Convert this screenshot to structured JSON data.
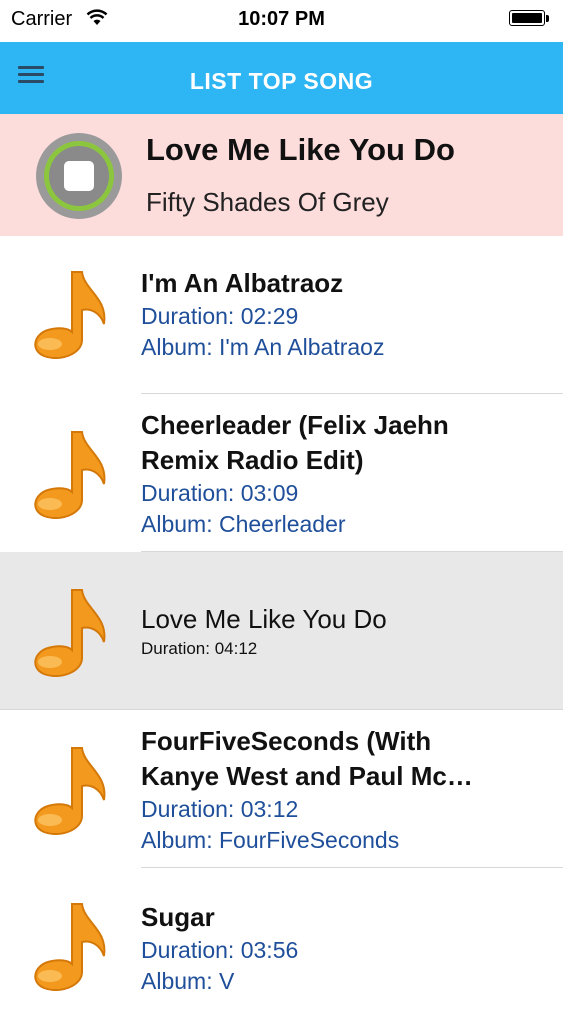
{
  "status_bar": {
    "carrier": "Carrier",
    "time": "10:07 PM"
  },
  "nav": {
    "title": "LIST TOP SONG"
  },
  "now_playing": {
    "title": "Love Me Like You Do",
    "subtitle": "Fifty Shades Of Grey"
  },
  "songs": [
    {
      "title": "I'm An Albatraoz",
      "duration": "Duration: 02:29",
      "album": "Album: I'm An Albatraoz"
    },
    {
      "title_line1": "Cheerleader (Felix Jaehn",
      "title_line2": "Remix Radio Edit)",
      "duration": "Duration: 03:09",
      "album": "Album: Cheerleader"
    },
    {
      "title": "Love Me Like You Do",
      "duration": "Duration: 04:12"
    },
    {
      "title_line1": "FourFiveSeconds  (With",
      "title_line2": "Kanye West and Paul Mc…",
      "duration": "Duration: 03:12",
      "album": "Album: FourFiveSeconds"
    },
    {
      "title": "Sugar",
      "duration": "Duration: 03:56",
      "album": "Album: V"
    }
  ],
  "colors": {
    "nav_background": "#2eb5f4",
    "now_playing_background": "#fddcdc",
    "selected_row_background": "#e8e8e8",
    "meta_text": "#1f4f9a",
    "note_icon": "#f39a1e"
  }
}
